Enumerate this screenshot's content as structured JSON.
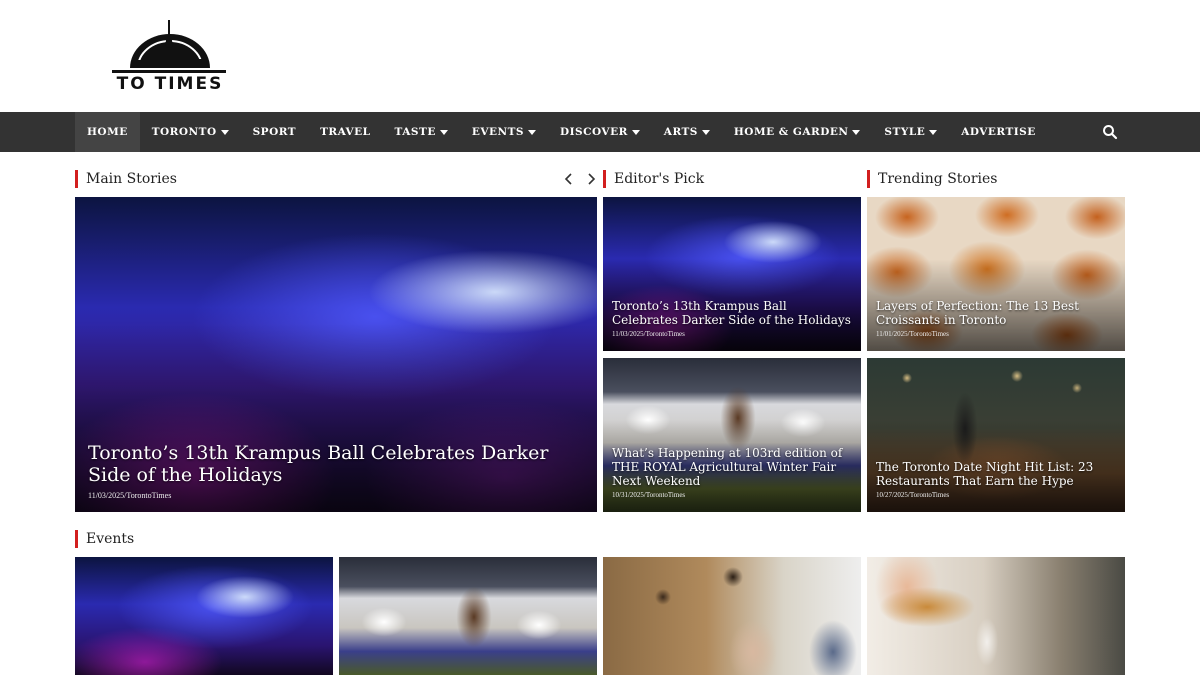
{
  "logo": {
    "text": "TO TIMES",
    "icon": "toronto-skyline-logo"
  },
  "nav": {
    "items": [
      {
        "label": "HOME",
        "dropdown": false
      },
      {
        "label": "TORONTO",
        "dropdown": true
      },
      {
        "label": "SPORT",
        "dropdown": false
      },
      {
        "label": "TRAVEL",
        "dropdown": false
      },
      {
        "label": "TASTE",
        "dropdown": true
      },
      {
        "label": "EVENTS",
        "dropdown": true
      },
      {
        "label": "DISCOVER",
        "dropdown": true
      },
      {
        "label": "ARTS",
        "dropdown": true
      },
      {
        "label": "HOME & GARDEN",
        "dropdown": true
      },
      {
        "label": "STYLE",
        "dropdown": true
      },
      {
        "label": "ADVERTISE",
        "dropdown": false
      }
    ],
    "search_icon": "search-icon"
  },
  "sections": {
    "main_stories": "Main Stories",
    "editors_pick": "Editor's Pick",
    "trending": "Trending Stories",
    "events": "Events"
  },
  "main_story": {
    "title": "Toronto’s 13th Krampus Ball Celebrates Darker Side of the Holidays",
    "meta": "11/03/2025/TorontoTimes"
  },
  "editors_pick": [
    {
      "title": "Toronto’s 13th Krampus Ball Celebrates Darker Side of the Holidays",
      "meta": "11/03/2025/TorontoTimes"
    },
    {
      "title": "What’s Happening at 103rd edition of THE ROYAL Agricultural Winter Fair Next Weekend",
      "meta": "10/31/2025/TorontoTimes"
    }
  ],
  "trending": [
    {
      "title": "Layers of Perfection: The 13 Best Croissants in Toronto",
      "meta": "11/01/2025/TorontoTimes"
    },
    {
      "title": "The Toronto Date Night Hit List: 23 Restaurants That Earn the Hype",
      "meta": "10/27/2025/TorontoTimes"
    }
  ],
  "colors": {
    "nav_bg": "#333333",
    "accent": "#d21f1f"
  }
}
